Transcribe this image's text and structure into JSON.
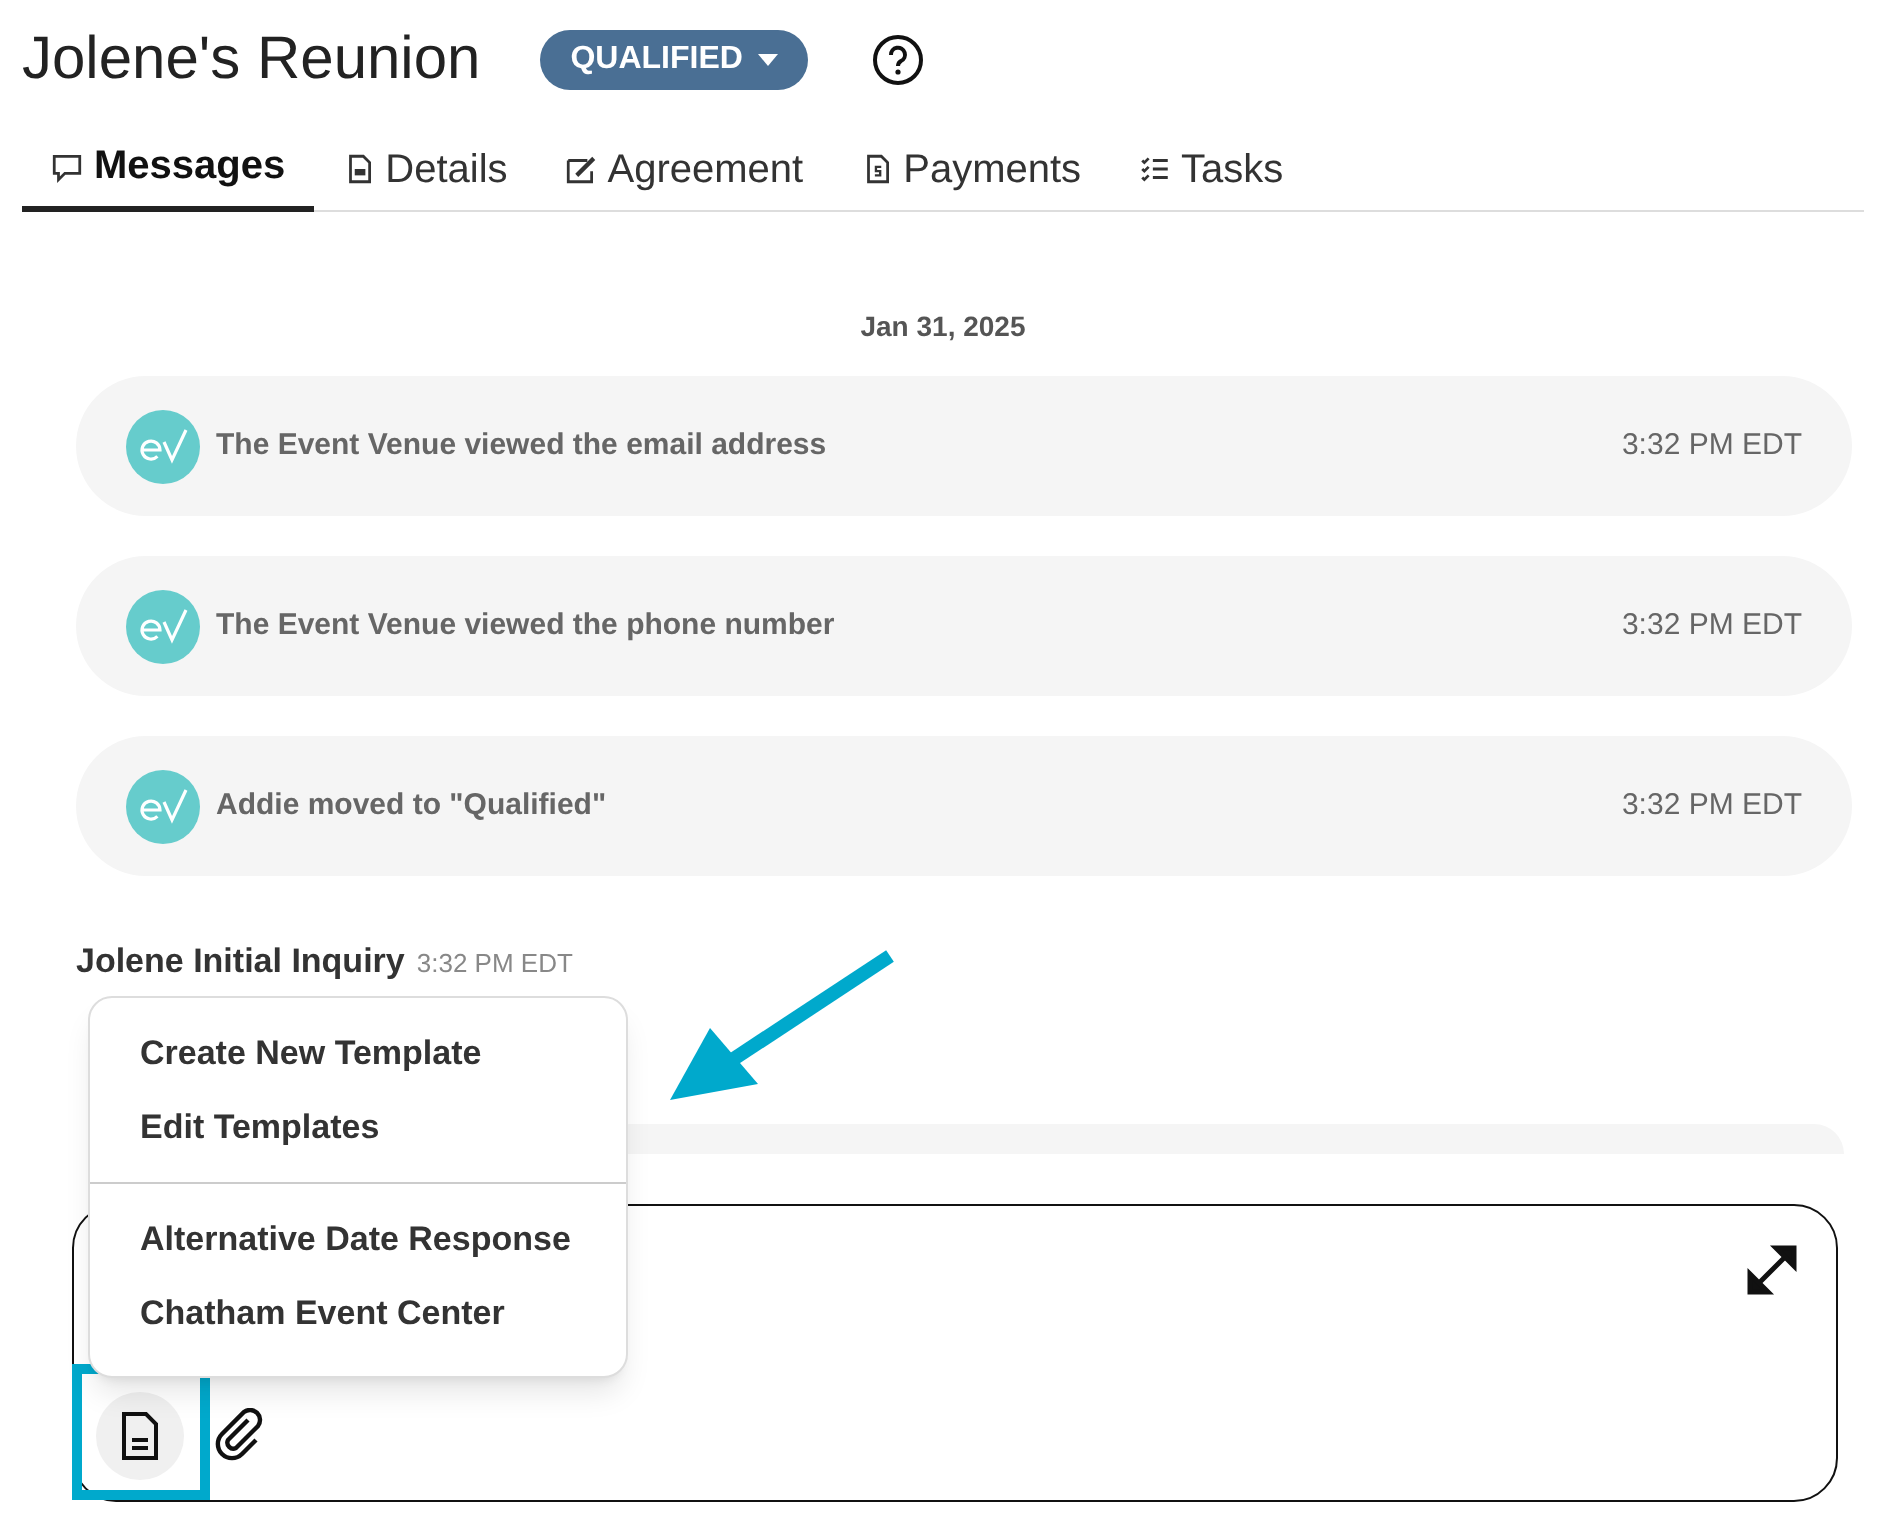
{
  "header": {
    "title": "Jolene's Reunion",
    "status": "QUALIFIED"
  },
  "tabs": [
    {
      "label": "Messages",
      "selected": true,
      "kind": "chat"
    },
    {
      "label": "Details",
      "selected": false,
      "kind": "doc"
    },
    {
      "label": "Agreement",
      "selected": false,
      "kind": "sign"
    },
    {
      "label": "Payments",
      "selected": false,
      "kind": "money"
    },
    {
      "label": "Tasks",
      "selected": false,
      "kind": "list"
    }
  ],
  "date": "Jan 31, 2025",
  "events": [
    {
      "text": "The Event Venue viewed the email address",
      "time": "3:32 PM EDT"
    },
    {
      "text": "The Event Venue viewed the phone number",
      "time": "3:32 PM EDT"
    },
    {
      "text": "Addie moved to \"Qualified\"",
      "time": "3:32 PM EDT"
    }
  ],
  "message": {
    "title": "Jolene Initial Inquiry",
    "time": "3:32 PM EDT"
  },
  "template_menu": {
    "actions": [
      "Create New Template",
      "Edit Templates"
    ],
    "templates": [
      "Alternative Date Response",
      "Chatham Event Center"
    ]
  }
}
